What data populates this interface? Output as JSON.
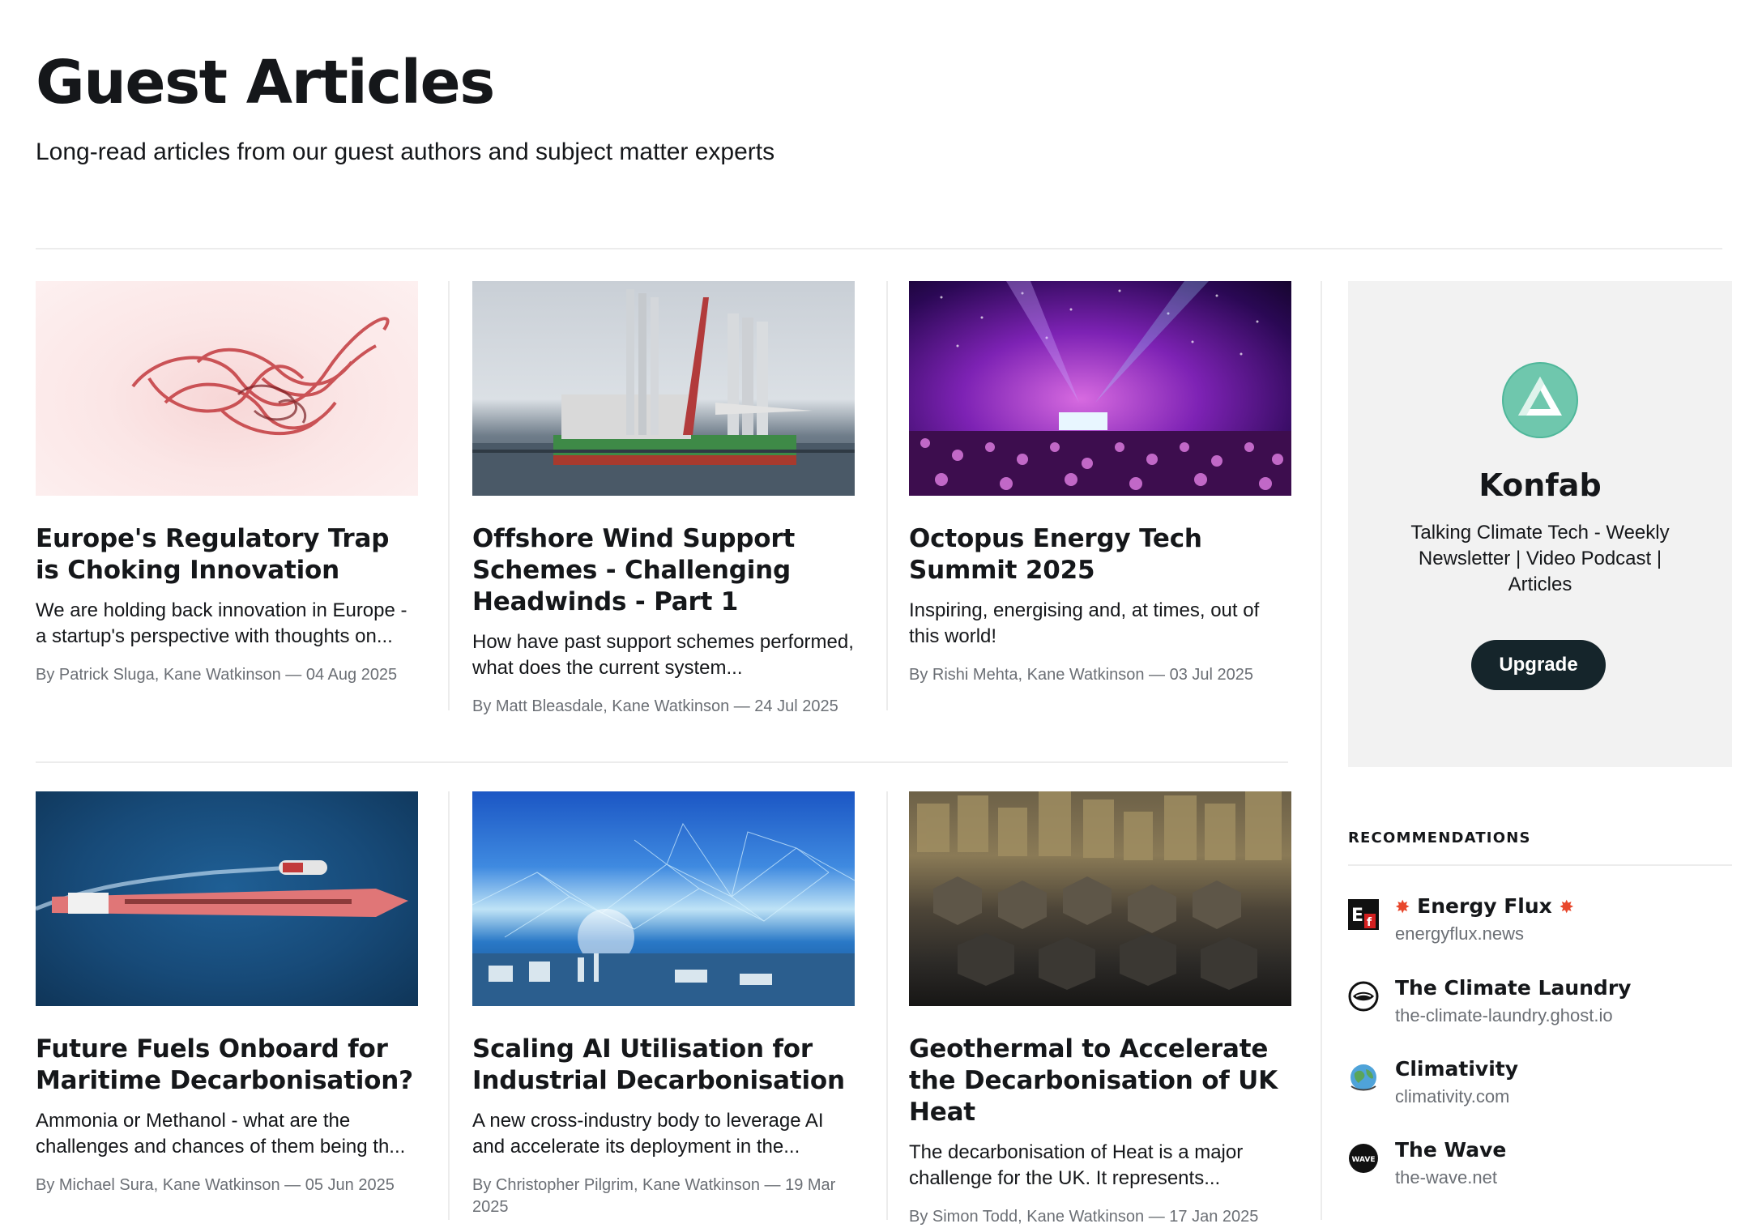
{
  "header": {
    "title": "Guest Articles",
    "description": "Long-read articles from our guest authors and subject matter experts"
  },
  "articles": [
    {
      "title": "Europe's Regulatory Trap is Choking Innovation",
      "excerpt": "We are holding back innovation in Europe - a startup's perspective with thoughts on...",
      "meta": "By Patrick Sluga, Kane Watkinson — 04 Aug 2025"
    },
    {
      "title": "Offshore Wind Support Schemes - Challenging Headwinds - Part 1",
      "excerpt": "How have past support schemes performed, what does the current system...",
      "meta": "By Matt Bleasdale, Kane Watkinson — 24 Jul 2025"
    },
    {
      "title": "Octopus Energy Tech Summit 2025",
      "excerpt": "Inspiring, energising and, at times, out of this world!",
      "meta": "By Rishi Mehta, Kane Watkinson — 03 Jul 2025"
    },
    {
      "title": "Future Fuels Onboard for Maritime Decarbonisation?",
      "excerpt": "Ammonia or Methanol - what are the challenges and chances of them being th...",
      "meta": "By Michael Sura, Kane Watkinson — 05 Jun 2025"
    },
    {
      "title": "Scaling AI Utilisation for Industrial Decarbonisation",
      "excerpt": "A new cross-industry body to leverage AI and accelerate its deployment in the...",
      "meta": "By Christopher Pilgrim, Kane Watkinson — 19 Mar 2025"
    },
    {
      "title": "Geothermal to Accelerate the Decarbonisation of UK Heat",
      "excerpt": "The decarbonisation of Heat is a major challenge for the UK. It represents...",
      "meta": "By Simon Todd, Kane Watkinson — 17 Jan 2025"
    }
  ],
  "sidebar": {
    "publication": {
      "name": "Konfab",
      "tagline": "Talking Climate Tech - Weekly Newsletter | Video Podcast | Articles",
      "upgrade_label": "Upgrade"
    },
    "recommendations": {
      "heading": "RECOMMENDATIONS",
      "items": [
        {
          "name": "Energy Flux",
          "url": "energyflux.news",
          "icon": "energy-flux-logo"
        },
        {
          "name": "The Climate Laundry",
          "url": "the-climate-laundry.ghost.io",
          "icon": "climate-laundry-logo"
        },
        {
          "name": "Climativity",
          "url": "climativity.com",
          "icon": "globe-icon"
        },
        {
          "name": "The Wave",
          "url": "the-wave.net",
          "icon": "wave-logo"
        }
      ]
    }
  },
  "colors": {
    "text": "#15171a",
    "meta": "#6b6f75",
    "button": "#15252b",
    "panel": "#f2f2f2",
    "brand_teal": "#4fb79a"
  }
}
